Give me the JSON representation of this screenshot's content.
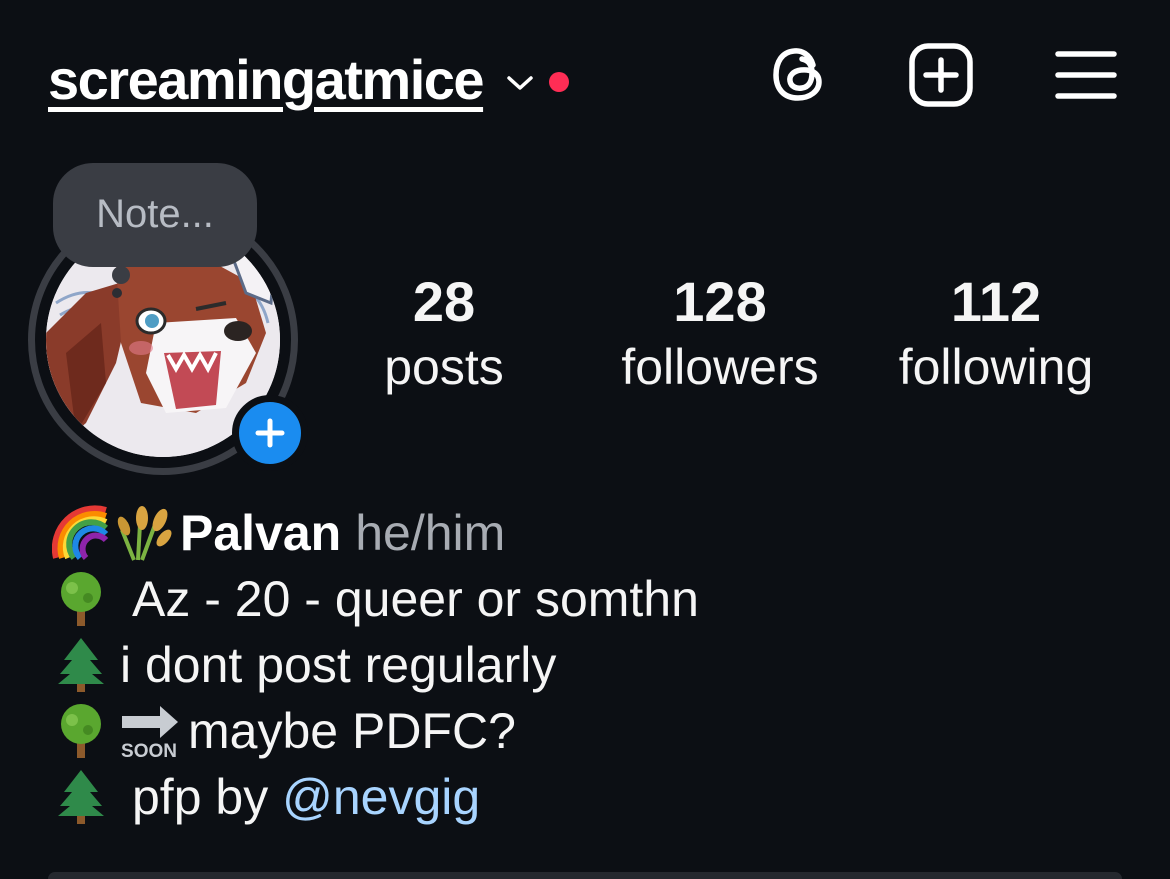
{
  "header": {
    "username": "screamingatmice",
    "notification_dot_color": "#ff2d55"
  },
  "profile": {
    "note_placeholder": "Note...",
    "stats": [
      {
        "value": "28",
        "label": "posts"
      },
      {
        "value": "128",
        "label": "followers"
      },
      {
        "value": "112",
        "label": "following"
      }
    ]
  },
  "bio": {
    "name": "Palvan",
    "pronouns": "he/him",
    "lines": [
      "Az - 20 - queer or somthn",
      "i dont post regularly",
      "maybe PDFC?",
      "pfp by "
    ],
    "mention": "@nevgig",
    "line_icons": [
      "deciduous-tree-icon",
      "evergreen-tree-icon",
      "deciduous-tree-icon",
      "evergreen-tree-icon"
    ],
    "name_icons": [
      "rainbow-icon",
      "rice-sheaf-icon"
    ],
    "soon_icon": "soon-arrow-icon",
    "soon_label": "SOON"
  },
  "colors": {
    "background": "#0c0f14",
    "accent_blue": "#1a8cf0",
    "mention": "#a8d4ff"
  }
}
